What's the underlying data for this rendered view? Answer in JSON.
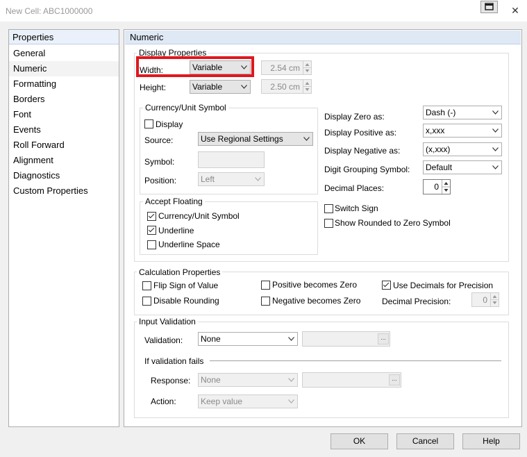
{
  "window": {
    "title": "New Cell: ABC1000000"
  },
  "sidebar": {
    "header": "Properties",
    "items": [
      "General",
      "Numeric",
      "Formatting",
      "Borders",
      "Font",
      "Events",
      "Roll Forward",
      "Alignment",
      "Diagnostics",
      "Custom Properties"
    ]
  },
  "panel": {
    "title": "Numeric"
  },
  "display": {
    "group_title": "Display Properties",
    "width_label": "Width:",
    "width_value": "Variable",
    "width_size": "2.54 cm",
    "height_label": "Height:",
    "height_value": "Variable",
    "height_size": "2.50 cm"
  },
  "currency": {
    "group_title": "Currency/Unit Symbol",
    "display_label": "Display",
    "source_label": "Source:",
    "source_value": "Use Regional Settings",
    "symbol_label": "Symbol:",
    "position_label": "Position:",
    "position_value": "Left"
  },
  "accept": {
    "group_title": "Accept Floating",
    "currency_label": "Currency/Unit Symbol",
    "underline_label": "Underline",
    "underline_space_label": "Underline Space"
  },
  "right": {
    "zero_label": "Display Zero as:",
    "zero_value": "Dash (-)",
    "positive_label": "Display Positive as:",
    "positive_value": "x,xxx",
    "negative_label": "Display Negative as:",
    "negative_value": "(x,xxx)",
    "grouping_label": "Digit Grouping Symbol:",
    "grouping_value": "Default",
    "decimal_label": "Decimal Places:",
    "decimal_value": "0",
    "switch_sign_label": "Switch Sign",
    "rounded_label": "Show Rounded to Zero Symbol"
  },
  "calc": {
    "group_title": "Calculation Properties",
    "flip_label": "Flip Sign of Value",
    "disable_rounding_label": "Disable Rounding",
    "positive_zero_label": "Positive becomes Zero",
    "negative_zero_label": "Negative becomes Zero",
    "use_decimals_label": "Use Decimals for Precision",
    "precision_label": "Decimal Precision:",
    "precision_value": "0"
  },
  "validation": {
    "group_title": "Input Validation",
    "validation_label": "Validation:",
    "validation_value": "None",
    "fails_label": "If validation fails",
    "response_label": "Response:",
    "response_value": "None",
    "action_label": "Action:",
    "action_value": "Keep value",
    "ellipsis": "..."
  },
  "buttons": {
    "ok": "OK",
    "cancel": "Cancel",
    "help": "Help"
  },
  "colors": {
    "highlight": "#e0171e",
    "header_blue": "#dfe8f5"
  }
}
